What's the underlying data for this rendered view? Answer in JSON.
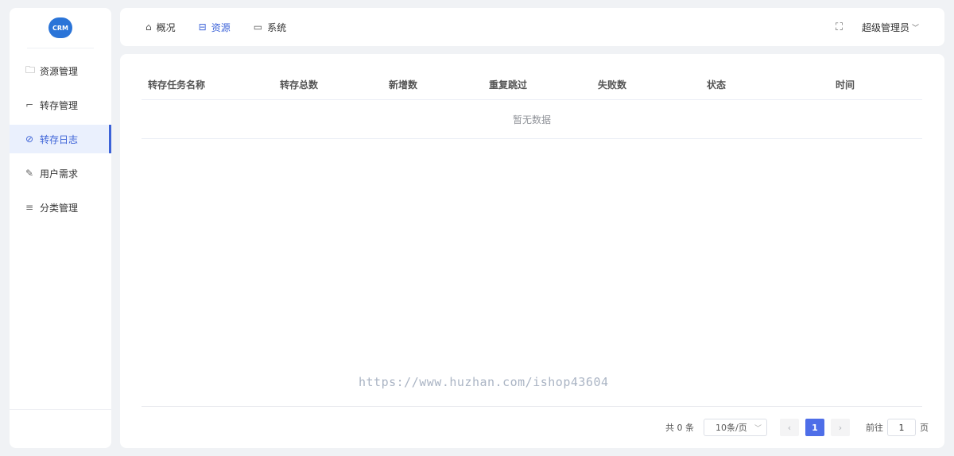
{
  "logo": {
    "text": "CRM",
    "color": "#2a74d8"
  },
  "sidebar": {
    "items": [
      {
        "label": "资源管理",
        "icon": "folder-icon"
      },
      {
        "label": "转存管理",
        "icon": "crop-icon"
      },
      {
        "label": "转存日志",
        "icon": "compass-icon",
        "active": true
      },
      {
        "label": "用户需求",
        "icon": "edit-icon"
      },
      {
        "label": "分类管理",
        "icon": "sliders-icon"
      }
    ]
  },
  "topnav": {
    "items": [
      {
        "label": "概况",
        "icon": "home-icon"
      },
      {
        "label": "资源",
        "icon": "box-icon",
        "active": true
      },
      {
        "label": "系统",
        "icon": "monitor-icon"
      }
    ],
    "user": "超级管理员"
  },
  "table": {
    "columns": [
      "转存任务名称",
      "转存总数",
      "新增数",
      "重复跳过",
      "失败数",
      "状态",
      "时间"
    ],
    "empty_text": "暂无数据"
  },
  "watermark": "https://www.huzhan.com/ishop43604",
  "pagination": {
    "total_text": "共 0 条",
    "page_size": "10条/页",
    "current_page": "1",
    "goto_prefix": "前往",
    "goto_value": "1",
    "goto_suffix": "页"
  },
  "colors": {
    "accent": "#3d63d8",
    "pager_active": "#4e6ee8"
  }
}
